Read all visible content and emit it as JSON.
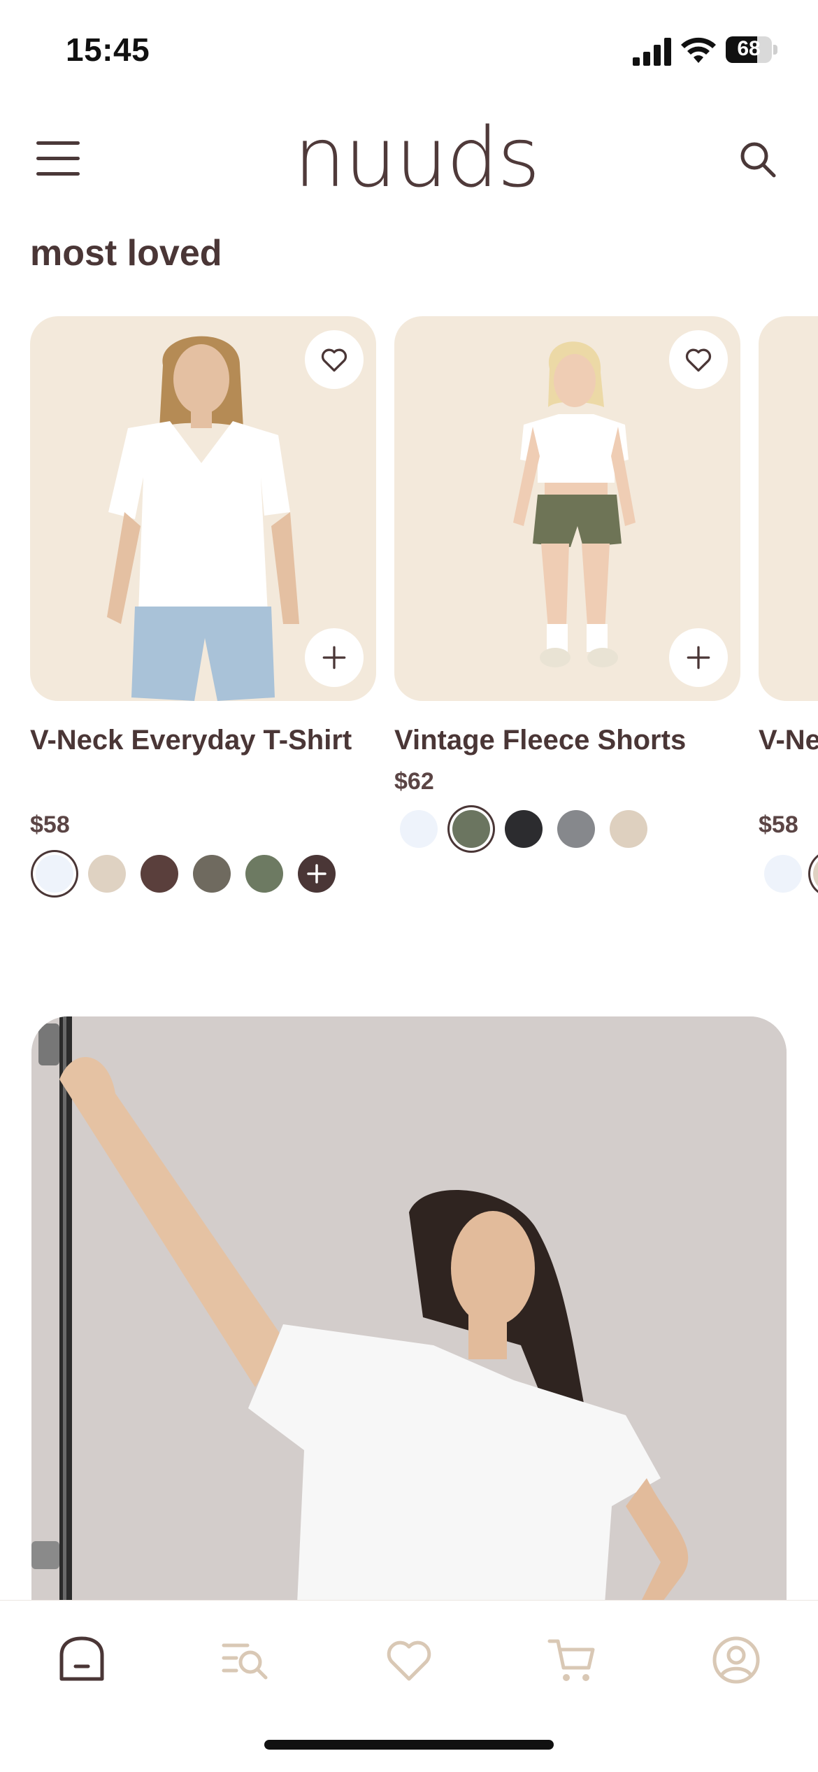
{
  "status_bar": {
    "time": "15:45",
    "battery": "68",
    "battery_level": 0.68
  },
  "header": {
    "logo": "nuuds",
    "menu_icon": "hamburger-menu-icon",
    "search_icon": "search-icon"
  },
  "section": {
    "title": "most loved"
  },
  "products": [
    {
      "name": "V-Neck Everyday T-Shirt",
      "price": "$58",
      "swatches": [
        "#eef3fb",
        "#dfd2c2",
        "#5a3f3c",
        "#6f6a5f",
        "#6d7a62"
      ],
      "selected_swatch": 0,
      "has_more": true
    },
    {
      "name": "Vintage Fleece Shorts",
      "price": "$62",
      "swatches": [
        "#eef3fb",
        "#6b7560",
        "#2c2c2f",
        "#86888c",
        "#ded0bf"
      ],
      "selected_swatch": 1,
      "has_more": false
    },
    {
      "name": "V-Neck Everyday T-Shirt",
      "price": "$58"
    }
  ],
  "colors": {
    "brand_text": "#4a3636",
    "card_bg": "#f3e9db",
    "inactive_tab": "#d9c8b5"
  },
  "tabbar": {
    "items": [
      {
        "name": "home",
        "icon": "home-icon",
        "active": true
      },
      {
        "name": "browse",
        "icon": "browse-search-icon",
        "active": false
      },
      {
        "name": "favorites",
        "icon": "heart-icon",
        "active": false
      },
      {
        "name": "cart",
        "icon": "cart-icon",
        "active": false
      },
      {
        "name": "account",
        "icon": "profile-icon",
        "active": false
      }
    ]
  }
}
